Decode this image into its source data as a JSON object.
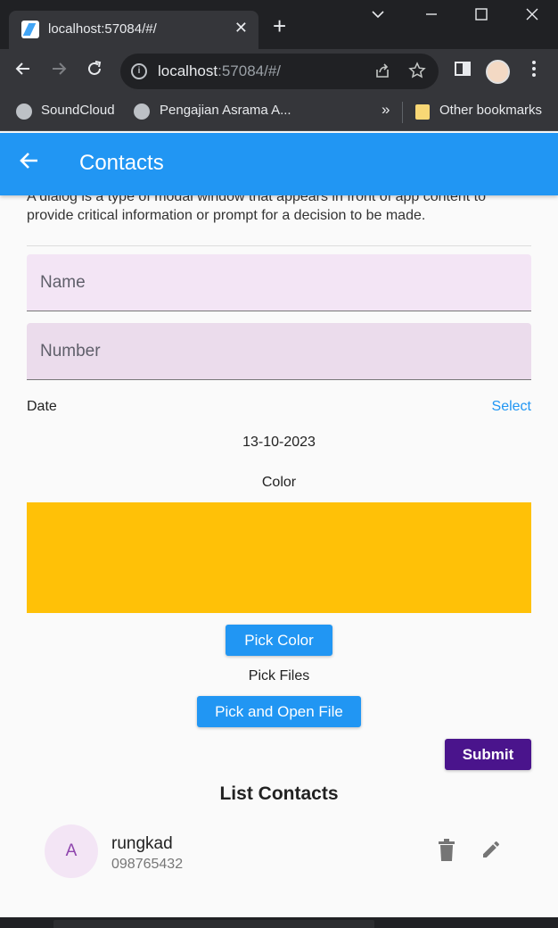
{
  "browser": {
    "tab_title": "localhost:57084/#/",
    "tab_close": "✕",
    "new_tab": "+",
    "url_host": "localhost",
    "url_rest": ":57084/#/",
    "bookmarks": [
      "SoundCloud",
      "Pengajian Asrama A..."
    ],
    "bookmarks_more": "»",
    "other_bookmarks": "Other bookmarks"
  },
  "appbar": {
    "title": "Contacts",
    "color": "#2196f3"
  },
  "form": {
    "description": "A dialog is a type of modal window that appears in front of app content to provide critical information or prompt for a decision to be made.",
    "name_placeholder": "Name",
    "number_placeholder": "Number",
    "date_label": "Date",
    "select_label": "Select",
    "date_value": "13-10-2023",
    "color_label": "Color",
    "picked_color": "#ffc107",
    "pick_color_label": "Pick Color",
    "pick_files_label": "Pick Files",
    "pick_open_file_label": "Pick and Open File",
    "submit_label": "Submit",
    "name_field_color": "#f3e5f5",
    "number_field_color": "#ebdcec",
    "button_color": "#2196f3",
    "submit_color": "#4a148c"
  },
  "list": {
    "title": "List Contacts",
    "items": [
      {
        "initial": "A",
        "name": "rungkad",
        "phone": "098765432"
      }
    ]
  }
}
